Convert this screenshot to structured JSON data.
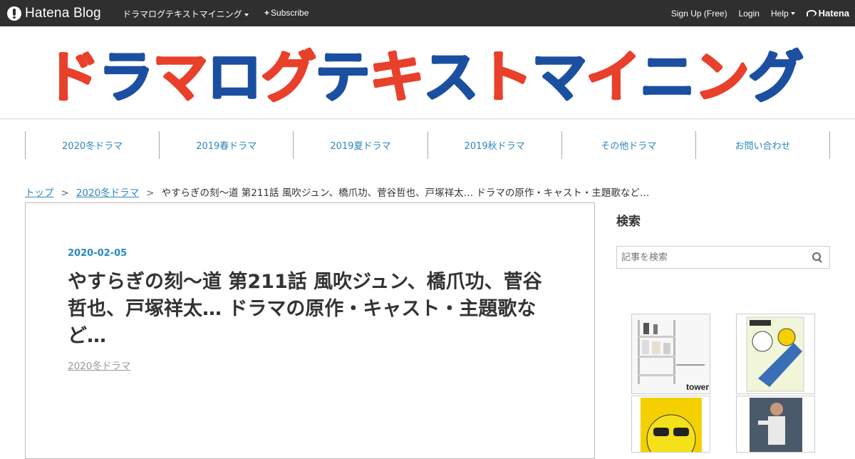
{
  "topbar": {
    "logo_text": "Hatena Blog",
    "blog_name": "ドラマログテキストマイニング",
    "subscribe_label": "Subscribe",
    "signup_label": "Sign Up (Free)",
    "login_label": "Login",
    "help_label": "Help",
    "hatena_label": "Hatena"
  },
  "header": {
    "title": "ドラマログテキストマイニング",
    "colors": {
      "red": "#e8402b",
      "blue": "#1b4fa0"
    }
  },
  "nav": {
    "items": [
      {
        "label": "2020冬ドラマ"
      },
      {
        "label": "2019春ドラマ"
      },
      {
        "label": "2019夏ドラマ"
      },
      {
        "label": "2019秋ドラマ"
      },
      {
        "label": "その他ドラマ"
      },
      {
        "label": "お問い合わせ"
      }
    ]
  },
  "breadcrumb": {
    "home": "トップ",
    "separator": ">",
    "category": "2020冬ドラマ",
    "current": "やすらぎの刻～道 第211話 風吹ジュン、橋爪功、菅谷哲也、戸塚祥太… ドラマの原作・キャスト・主題歌など…"
  },
  "article": {
    "date": "2020-02-05",
    "title": "やすらぎの刻～道 第211話 風吹ジュン、橋爪功、菅谷哲也、戸塚祥太… ドラマの原作・キャスト・主題歌など…",
    "category": "2020冬ドラマ"
  },
  "sidebar": {
    "search_title": "検索",
    "search_placeholder": "記事を検索",
    "ad_brand_text": "tower"
  },
  "accent_color": "#2b88c1"
}
